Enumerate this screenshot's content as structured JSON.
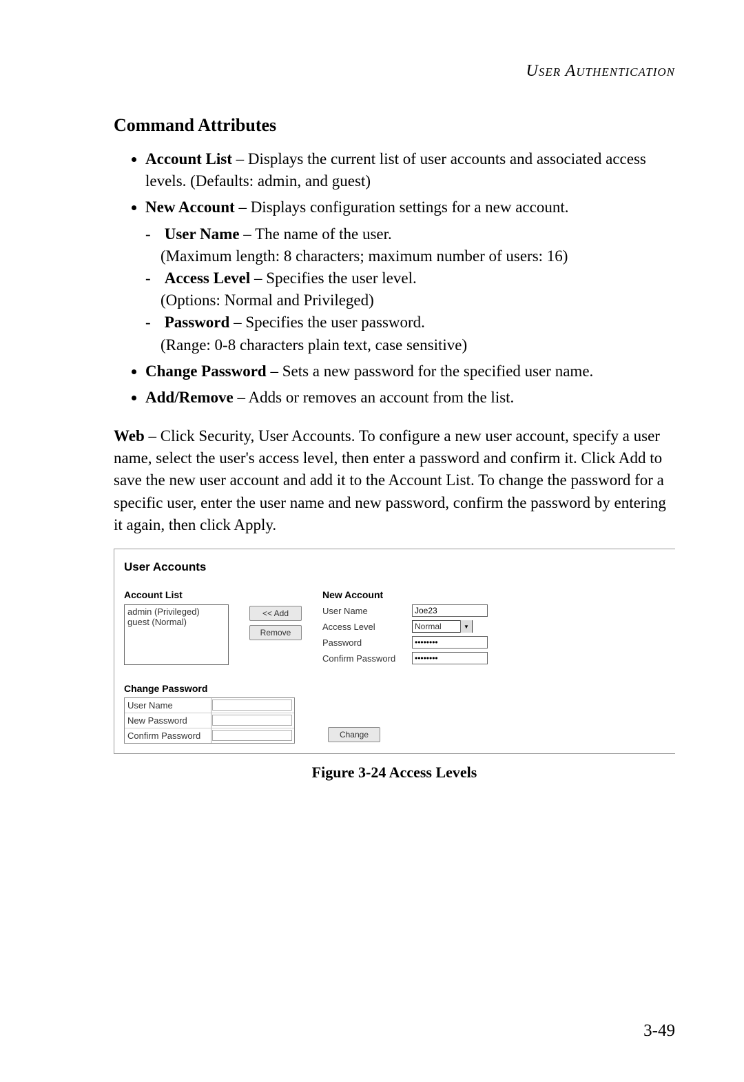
{
  "header": "User Authentication",
  "section_title": "Command Attributes",
  "attrs": {
    "account_list": {
      "name": "Account List",
      "desc": " – Displays the current list of user accounts and associated access levels. (Defaults: admin, and guest)"
    },
    "new_account": {
      "name": "New Account",
      "desc": " – Displays configuration settings for a new account.",
      "sub": {
        "user_name": {
          "name": "User Name",
          "desc": " – The name of the user.",
          "note": "(Maximum length: 8 characters; maximum number of users: 16)"
        },
        "access_level": {
          "name": "Access Level",
          "desc": " – Specifies the user level.",
          "note": "(Options: Normal and Privileged)"
        },
        "password": {
          "name": "Password",
          "desc": " – Specifies the user password.",
          "note": "(Range: 0-8 characters plain text, case sensitive)"
        }
      }
    },
    "change_password": {
      "name": "Change Password",
      "desc": " – Sets a new password for the specified user name."
    },
    "add_remove": {
      "name": "Add/Remove",
      "desc": " – Adds or removes an account from the list."
    }
  },
  "web_para_lead": "Web",
  "web_para": " – Click Security, User Accounts. To configure a new user account, specify a user name, select the user's access level, then enter a password and confirm it. Click Add to save the new user account and add it to the Account List. To change the password for a specific user, enter the user name and new password, confirm the password by entering it again, then click Apply.",
  "figure": {
    "title": "User Accounts",
    "labels": {
      "account_list": "Account List",
      "new_account": "New Account",
      "change_password": "Change Password",
      "user_name": "User Name",
      "access_level": "Access Level",
      "password": "Password",
      "confirm_password": "Confirm Password",
      "new_password": "New Password"
    },
    "account_items": [
      "admin (Privileged)",
      "guest (Normal)"
    ],
    "buttons": {
      "add": "<< Add",
      "remove": "Remove",
      "change": "Change"
    },
    "form": {
      "user_name_value": "Joe23",
      "access_level_value": "Normal",
      "password_value": "********",
      "confirm_value": "********"
    },
    "change_values": {
      "user_name": "",
      "new_password": "",
      "confirm": ""
    },
    "caption": "Figure 3-24  Access Levels"
  },
  "page_number": "3-49"
}
